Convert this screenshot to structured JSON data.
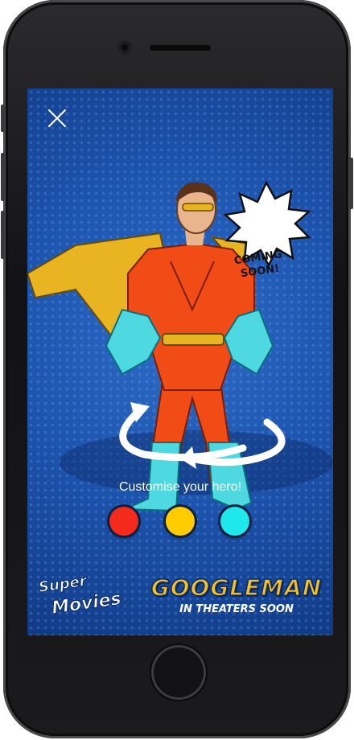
{
  "bubble": {
    "line1": "COMING",
    "line2": "SOON!"
  },
  "tagline": "Customise your hero!",
  "colors": {
    "swatches": [
      {
        "name": "red",
        "hex": "#f42a1c"
      },
      {
        "name": "yellow",
        "hex": "#ffcc00"
      },
      {
        "name": "cyan",
        "hex": "#1ee8ec"
      }
    ],
    "suit": "#f24c16",
    "cape": "#e8b422",
    "gloves": "#4ed8e0"
  },
  "brand": {
    "line1": "Super",
    "line2": "Movies"
  },
  "movie": {
    "title": "GOOGLEMAN",
    "subtitle": "IN THEATERS SOON"
  },
  "icons": {
    "close": "close-icon",
    "rotate": "rotate-arrows-icon"
  }
}
